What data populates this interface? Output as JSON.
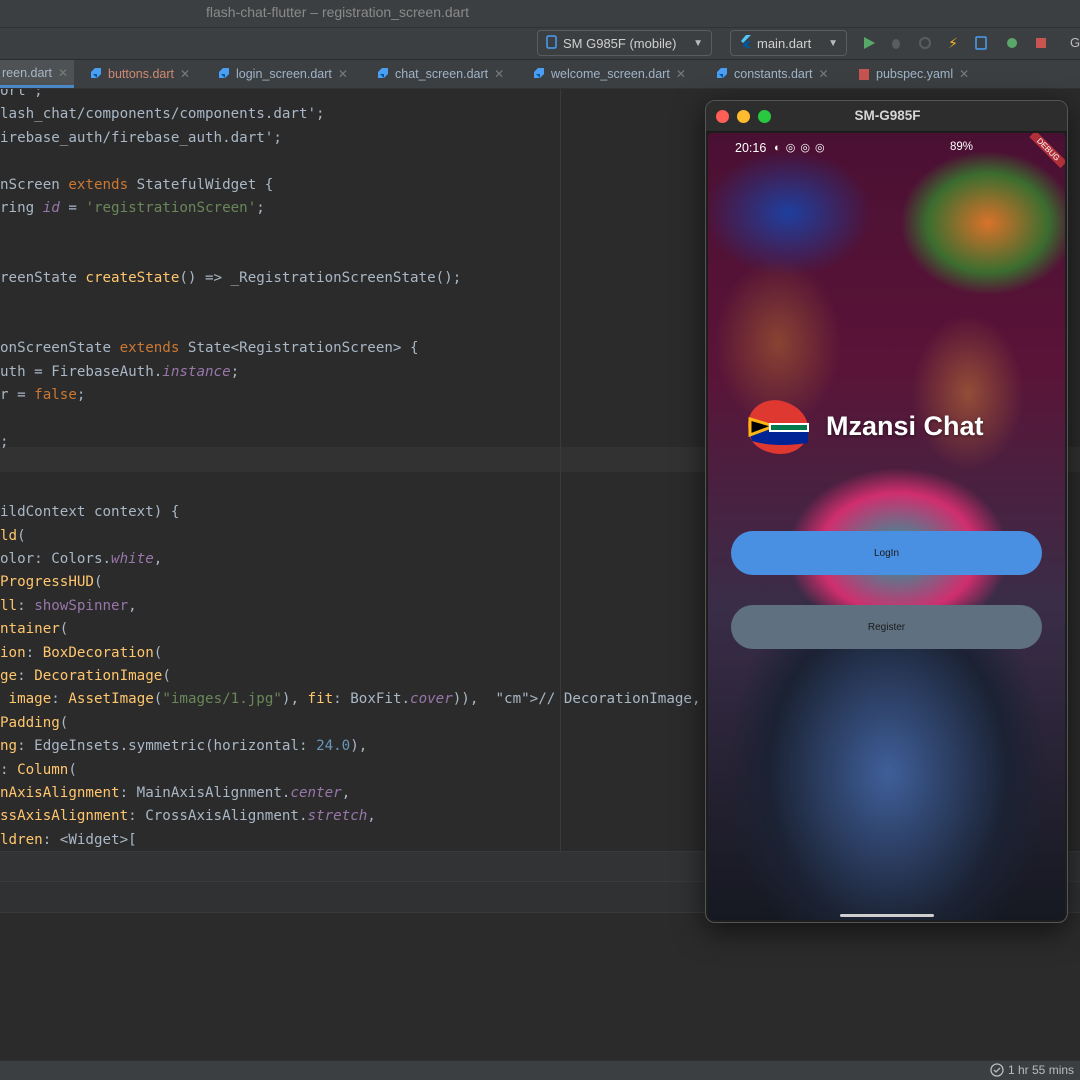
{
  "ide": {
    "window_title": "flash-chat-flutter – registration_screen.dart",
    "device_selector": "SM G985F (mobile)",
    "run_config": "main.dart",
    "toolbar_trailing": "G",
    "tabs": [
      {
        "label": "reen.dart",
        "state": "active"
      },
      {
        "label": "buttons.dart",
        "state": "modified"
      },
      {
        "label": "login_screen.dart"
      },
      {
        "label": "chat_screen.dart"
      },
      {
        "label": "welcome_screen.dart"
      },
      {
        "label": "constants.dart"
      },
      {
        "label": "pubspec.yaml"
      }
    ],
    "status_time": "1 hr 55 mins",
    "code_lines": [
      "ort ;",
      "lash_chat/components/components.dart';",
      "irebase_auth/firebase_auth.dart';",
      "",
      "nScreen extends StatefulWidget {",
      "ring id = 'registrationScreen';",
      "",
      "",
      "reenState createState() => _RegistrationScreenState();",
      "",
      "",
      "onScreenState extends State<RegistrationScreen> {",
      "uth = FirebaseAuth.instance;",
      "r = false;",
      "",
      ";",
      "",
      "",
      "ildContext context) {",
      "ld(",
      "olor: Colors.white,",
      "ProgressHUD(",
      "ll: showSpinner,",
      "ntainer(",
      "ion: BoxDecoration(",
      "ge: DecorationImage(",
      " image: AssetImage(\"images/1.jpg\"), fit: BoxFit.cover)),  // DecorationImage, Bo",
      "Padding(",
      "ng: EdgeInsets.symmetric(horizontal: 24.0),",
      ": Column(",
      "nAxisAlignment: MainAxisAlignment.center,",
      "ssAxisAlignment: CrossAxisAlignment.stretch,",
      "ldren: <Widget>["
    ]
  },
  "emulator": {
    "window_title": "SM-G985F",
    "status_time": "20:16",
    "status_notifications": "◐ ◎ ◎ ◎",
    "battery": "89%",
    "debug_banner": "DEBUG",
    "app_title": "Mzansi Chat",
    "login_label": "LogIn",
    "register_label": "Register",
    "colors": {
      "login": "#4a90e2",
      "register": "#5f7180"
    }
  },
  "icons": [
    "phone-icon",
    "flutter-icon",
    "run-icon",
    "debug-icon",
    "coverage-icon",
    "hot-reload-icon",
    "device-file-icon",
    "attach-icon",
    "stop-icon",
    "dart-file-icon",
    "yaml-file-icon",
    "close-icon",
    "clock-check-icon",
    "south-africa-flag-icon"
  ]
}
